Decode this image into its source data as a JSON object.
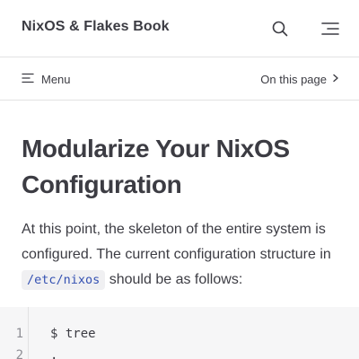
{
  "header": {
    "site_title": "NixOS & Flakes Book",
    "search_icon": "search-icon",
    "menu_icon": "hamburger-menu-icon"
  },
  "local_nav": {
    "menu_label": "Menu",
    "outline_label": "On this page"
  },
  "article": {
    "heading": "Modularize Your NixOS Configuration",
    "intro_before": "At this point, the skeleton of the entire system is configured. The current configuration structure in ",
    "intro_code": "/etc/nixos",
    "intro_after": " should be as follows:"
  },
  "code_block": {
    "line_numbers": [
      "1",
      "2"
    ],
    "lines": [
      "$ tree",
      "."
    ]
  },
  "colors": {
    "text": "#3c3c43",
    "border": "#e2e2e3",
    "code_bg": "#f6f6f7",
    "inline_code_text": "#3451b2"
  }
}
